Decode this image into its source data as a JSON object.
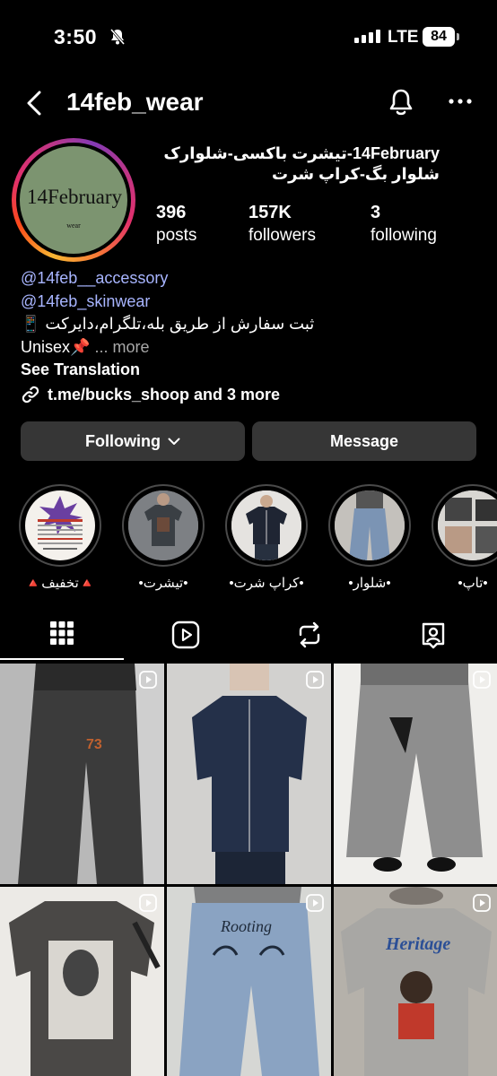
{
  "status_bar": {
    "time": "3:50",
    "network": "LTE",
    "battery": "84"
  },
  "header": {
    "username": "14feb_wear"
  },
  "profile": {
    "avatar_logo": {
      "main": "14February",
      "sub": "wear"
    },
    "full_name_line1": "14February-تیشرت باکسی-شلوارک",
    "full_name_line2": "شلوار بگ-کراپ شرت",
    "stats": [
      {
        "value": "396",
        "label": "posts"
      },
      {
        "value": "157K",
        "label": "followers"
      },
      {
        "value": "3",
        "label": "following"
      }
    ],
    "bio": {
      "mention1": "@14feb__accessory",
      "mention2": "@14feb_skinwear",
      "line3": "ثبت سفارش از طریق بله،تلگرام،دایرکت 📱",
      "line4": "Unisex📌",
      "more": "... more",
      "see_translation": "See Translation",
      "link": "t.me/bucks_shoop and 3 more"
    }
  },
  "buttons": {
    "following": "Following",
    "message": "Message"
  },
  "highlights": [
    {
      "label": "🔺تخفیف🔺"
    },
    {
      "label": "•تیشرت•"
    },
    {
      "label": "•کراپ شرت•"
    },
    {
      "label": "•شلوار•"
    },
    {
      "label": "•تاپ•"
    }
  ],
  "tabs": [
    {
      "icon": "grid-icon",
      "active": true
    },
    {
      "icon": "reels-icon",
      "active": false
    },
    {
      "icon": "reposts-icon",
      "active": false
    },
    {
      "icon": "tagged-icon",
      "active": false
    }
  ],
  "grid_posts": [
    {
      "type": "reel",
      "subject": "faded black baggy jeans",
      "print": "73"
    },
    {
      "type": "reel",
      "subject": "dark denim short-sleeve shirt"
    },
    {
      "type": "reel",
      "subject": "grey wash wide jeans"
    },
    {
      "type": "reel",
      "subject": "grey graphic t-shirt"
    },
    {
      "type": "reel",
      "subject": "light blue embroidered jeans",
      "print": "Rooting"
    },
    {
      "type": "reel",
      "subject": "Heritage graphic t-shirt",
      "print": "Heritage"
    }
  ],
  "colors": {
    "background": "#000000",
    "button": "#363636",
    "link": "#a8b5ff",
    "avatar_bg": "#7c9470"
  }
}
